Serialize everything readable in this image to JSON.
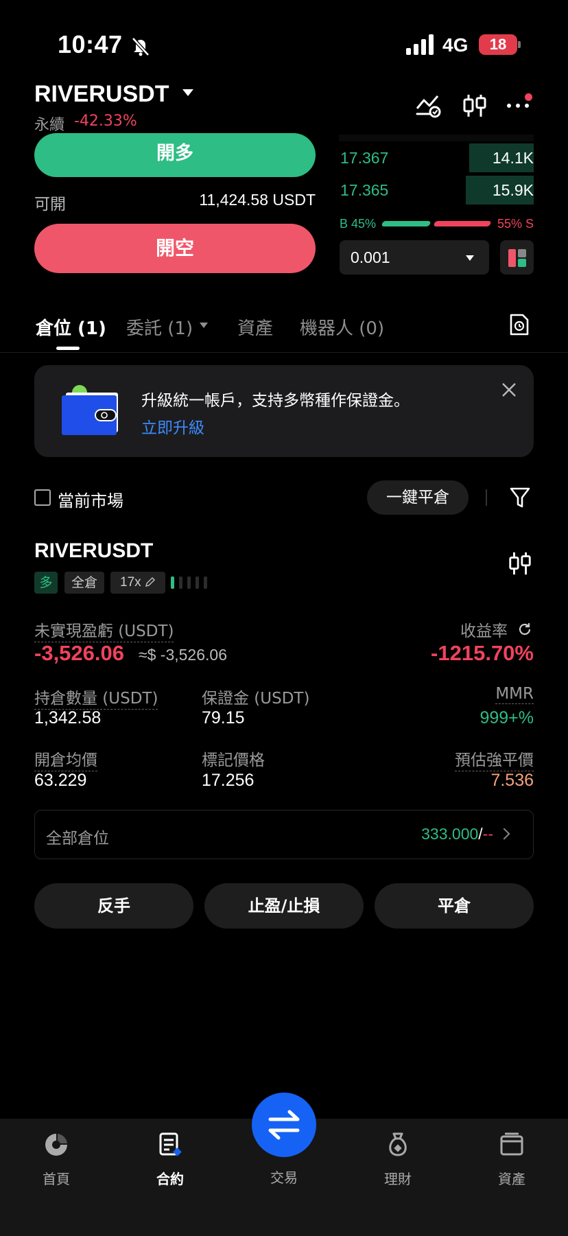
{
  "status_bar": {
    "time": "10:47",
    "network": "4G",
    "battery": "18"
  },
  "header": {
    "symbol": "RIVERUSDT",
    "contract_type": "永續",
    "change": "-42.33%"
  },
  "order_panel": {
    "long_label": "開多",
    "available_label": "可開",
    "available_value": "11,424.58 USDT",
    "short_label": "開空"
  },
  "order_book": {
    "rows": [
      {
        "price": "17.367",
        "qty": "14.1K",
        "depth": 0.33
      },
      {
        "price": "17.365",
        "qty": "15.9K",
        "depth": 0.35
      }
    ],
    "buy_ratio": "B 45%",
    "sell_ratio": "55% S",
    "buy_pct": 45,
    "quantity_step": "0.001"
  },
  "tabs": [
    {
      "label": "倉位 (1)"
    },
    {
      "label": "委託 (1)"
    },
    {
      "label": "資產"
    },
    {
      "label": "機器人 (0)"
    }
  ],
  "banner": {
    "title": "升級統一帳戶，支持多幣種作保證金。",
    "link": "立即升級"
  },
  "filter": {
    "current_market": "當前市場",
    "close_all": "一鍵平倉"
  },
  "position": {
    "symbol": "RIVERUSDT",
    "side": "多",
    "margin_mode": "全倉",
    "leverage": "17x",
    "unrealized_pnl_label": "未實現盈虧 (USDT)",
    "unrealized_pnl": "-3,526.06",
    "unrealized_pnl_approx": "≈$ -3,526.06",
    "roe_label": "收益率",
    "roe": "-1215.70%",
    "size_label": "持倉數量 (USDT)",
    "size": "1,342.58",
    "margin_label": "保證金 (USDT)",
    "margin": "79.15",
    "mmr_label": "MMR",
    "mmr": "999+%",
    "entry_label": "開倉均價",
    "entry": "63.229",
    "mark_label": "標記價格",
    "mark": "17.256",
    "liq_label": "預估強平價",
    "liq": "7.536",
    "all_positions_label": "全部倉位",
    "all_positions_value": "333.000",
    "all_positions_sep": "/",
    "all_positions_dash": "--",
    "actions": {
      "reverse": "反手",
      "tpsl": "止盈/止損",
      "close": "平倉"
    }
  },
  "bottom_nav": [
    {
      "label": "首頁"
    },
    {
      "label": "合約"
    },
    {
      "label": "交易"
    },
    {
      "label": "理財"
    },
    {
      "label": "資產"
    }
  ],
  "colors": {
    "green": "#2ebd85",
    "red": "#f0435c",
    "blue": "#1662f4",
    "orange": "#f5a37a"
  }
}
